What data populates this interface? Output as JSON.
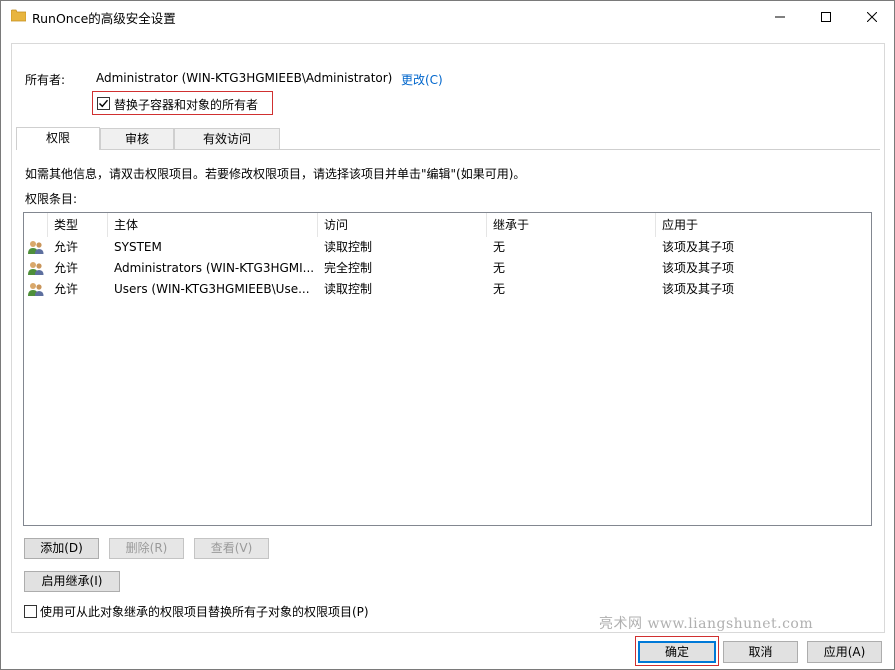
{
  "window": {
    "title": "RunOnce的高级安全设置"
  },
  "owner": {
    "label": "所有者:",
    "value": "Administrator (WIN-KTG3HGMIEEB\\Administrator)",
    "change_link": "更改(C)",
    "replace_checkbox_label": "替换子容器和对象的所有者",
    "replace_checked": true
  },
  "tabs": [
    {
      "label": "权限",
      "active": true
    },
    {
      "label": "审核",
      "active": false
    },
    {
      "label": "有效访问",
      "active": false
    }
  ],
  "info_text": "如需其他信息，请双击权限项目。若要修改权限项目，请选择该项目并单击\"编辑\"(如果可用)。",
  "entries_label": "权限条目:",
  "table": {
    "columns": [
      "类型",
      "主体",
      "访问",
      "继承于",
      "应用于"
    ],
    "rows": [
      {
        "type": "允许",
        "principal": "SYSTEM",
        "access": "读取控制",
        "inherited": "无",
        "applies": "该项及其子项"
      },
      {
        "type": "允许",
        "principal": "Administrators (WIN-KTG3HGMI...",
        "access": "完全控制",
        "inherited": "无",
        "applies": "该项及其子项"
      },
      {
        "type": "允许",
        "principal": "Users (WIN-KTG3HGMIEEB\\Use...",
        "access": "读取控制",
        "inherited": "无",
        "applies": "该项及其子项"
      }
    ]
  },
  "buttons": {
    "add": "添加(D)",
    "remove": "删除(R)",
    "view": "查看(V)",
    "enable_inheritance": "启用继承(I)"
  },
  "replace_child_perms": {
    "label": "使用可从此对象继承的权限项目替换所有子对象的权限项目(P)",
    "checked": false
  },
  "watermark": "亮术网 www.liangshunet.com",
  "footer": {
    "ok": "确定",
    "cancel": "取消",
    "apply": "应用(A)"
  },
  "colors": {
    "highlight": "#d03030",
    "link": "#0066cc",
    "default_button_border": "#0078d7"
  }
}
